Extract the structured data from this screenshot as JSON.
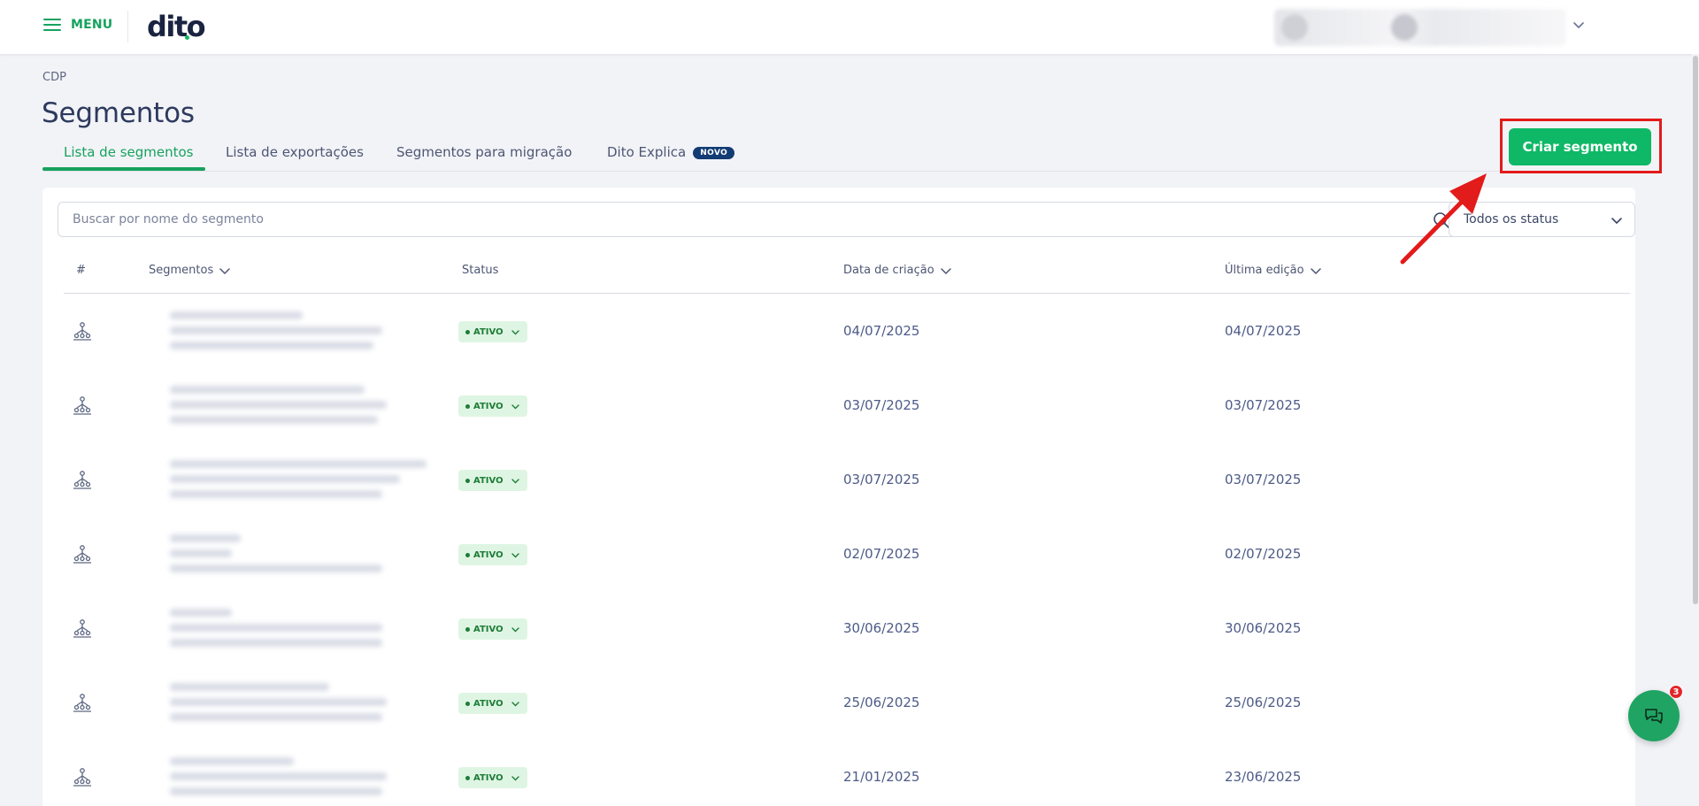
{
  "header": {
    "menu_label": "MENU",
    "logo": "dito"
  },
  "breadcrumb": "CDP",
  "page_title": "Segmentos",
  "tabs": [
    {
      "label": "Lista de segmentos",
      "active": true
    },
    {
      "label": "Lista de exportações",
      "active": false
    },
    {
      "label": "Segmentos para migração",
      "active": false
    },
    {
      "label": "Dito Explica",
      "active": false,
      "badge": "NOVO"
    }
  ],
  "cta_label": "Criar segmento",
  "search": {
    "placeholder": "Buscar por nome do segmento"
  },
  "status_filter": {
    "selected": "Todos os status"
  },
  "table": {
    "columns": [
      "#",
      "Segmentos",
      "Status",
      "Data de criação",
      "Última edição"
    ],
    "rows": [
      {
        "status": "ATIVO",
        "created": "04/07/2025",
        "edited": "04/07/2025"
      },
      {
        "status": "ATIVO",
        "created": "03/07/2025",
        "edited": "03/07/2025"
      },
      {
        "status": "ATIVO",
        "created": "03/07/2025",
        "edited": "03/07/2025"
      },
      {
        "status": "ATIVO",
        "created": "02/07/2025",
        "edited": "02/07/2025"
      },
      {
        "status": "ATIVO",
        "created": "30/06/2025",
        "edited": "30/06/2025"
      },
      {
        "status": "ATIVO",
        "created": "25/06/2025",
        "edited": "25/06/2025"
      },
      {
        "status": "ATIVO",
        "created": "21/01/2025",
        "edited": "23/06/2025"
      }
    ]
  },
  "chat": {
    "unread_count": "3"
  },
  "icons": {
    "menu": "hamburger-icon",
    "account_toggle": "chevron-down-icon",
    "search": "search-icon",
    "row": "segment-network-icon",
    "chat": "chat-bubbles-icon"
  },
  "colors": {
    "brand_green": "#16a25d",
    "cta_green": "#0fb866",
    "status_bg": "#dff5e3",
    "status_text": "#1d7d37",
    "annotation_red": "#e21b1b",
    "badge_navy": "#123c73"
  }
}
